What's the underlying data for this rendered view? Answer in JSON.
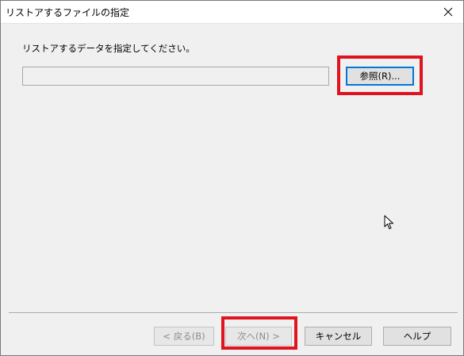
{
  "window": {
    "title": "リストアするファイルの指定"
  },
  "main": {
    "instruction": "リストアするデータを指定してください。",
    "path_value": "",
    "browse_label": "参照(R)..."
  },
  "footer": {
    "back_label": "< 戻る(B)",
    "next_label": "次へ(N) >",
    "cancel_label": "キャンセル",
    "help_label": "ヘルプ"
  },
  "icons": {
    "close": "close-icon",
    "cursor": "mouse-pointer-icon"
  },
  "colors": {
    "highlight": "#e0141e",
    "focus": "#0078d7",
    "dialog_bg": "#f0f0f0"
  }
}
